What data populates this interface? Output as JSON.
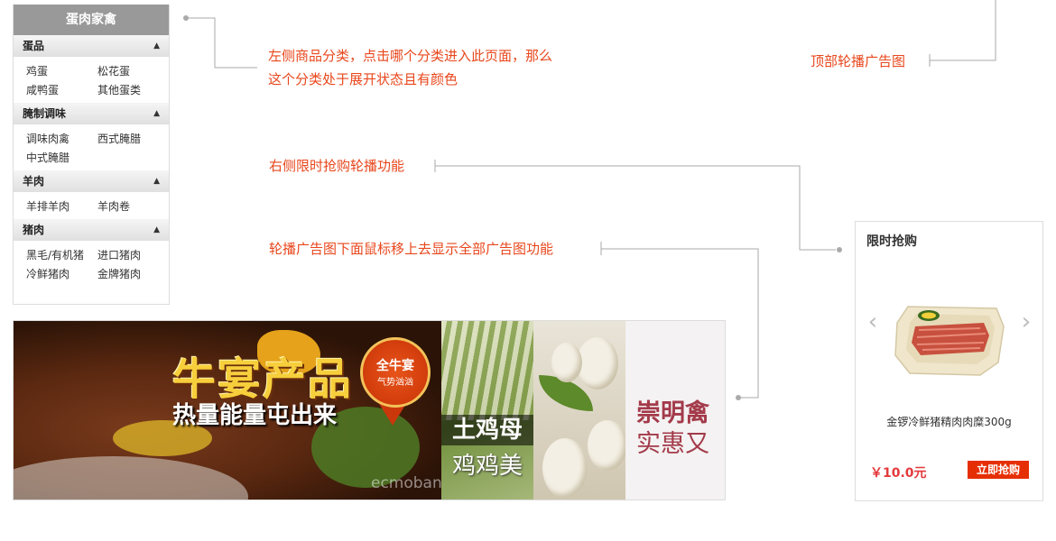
{
  "category_menu": {
    "title": "蛋肉家禽",
    "groups": [
      {
        "label": "蛋品",
        "items": [
          "鸡蛋",
          "松花蛋",
          "咸鸭蛋",
          "其他蛋类"
        ]
      },
      {
        "label": "腌制调味",
        "items": [
          "调味肉禽",
          "西式腌腊",
          "中式腌腊"
        ]
      },
      {
        "label": "羊肉",
        "items": [
          "羊排羊肉",
          "羊肉卷"
        ]
      },
      {
        "label": "猪肉",
        "items": [
          "黑毛/有机猪",
          "进口猪肉",
          "冷鲜猪肉",
          "金牌猪肉"
        ]
      }
    ],
    "expand_icon": "chevron-up-icon"
  },
  "annotations": {
    "left_category_line1": "左侧商品分类，点击哪个分类进入此页面，那么",
    "left_category_line2": "这个分类处于展开状态且有颜色",
    "top_banner": "顶部轮播广告图",
    "flash_sale_carousel": "右侧限时抢购轮播功能",
    "banner_hover": "轮播广告图下面鼠标移上去显示全部广告图功能"
  },
  "banner": {
    "slide1_title": "牛宴产品",
    "slide1_subtitle": "热量能量屯出来",
    "slide1_badge_main": "全牛宴",
    "slide1_badge_sub": "气势汹汹",
    "watermark": "ecmoban.com",
    "slide2_line1": "土鸡母",
    "slide2_line2": "鸡鸡美",
    "slide4_line1": "崇明禽",
    "slide4_line2": "实惠又"
  },
  "flash_sale": {
    "title": "限时抢购",
    "product_name": "金锣冷鲜猪精肉肉糜300g",
    "price": "￥10.0元",
    "buy_label": "立即抢购",
    "prev_icon": "chevron-left-icon",
    "next_icon": "chevron-right-icon"
  },
  "colors": {
    "annotation": "#e8471c",
    "menu_header": "#999999",
    "buy_button": "#e62e04",
    "price": "#e4393c"
  }
}
